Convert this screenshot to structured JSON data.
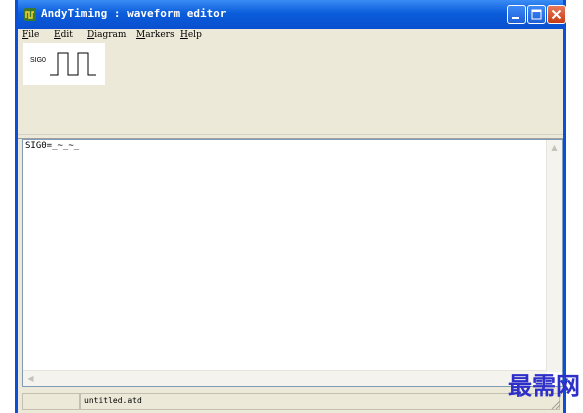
{
  "window": {
    "title": "AndyTiming : waveform editor",
    "buttons": {
      "minimize": "minimize",
      "maximize": "maximize",
      "close": "close"
    }
  },
  "menu": {
    "items": [
      {
        "label": "File",
        "accel": "F"
      },
      {
        "label": "Edit",
        "accel": "E"
      },
      {
        "label": "Diagram",
        "accel": "D"
      },
      {
        "label": "Markers",
        "accel": "M"
      },
      {
        "label": "Help",
        "accel": "H"
      }
    ]
  },
  "waveform": {
    "signal_label": "SIG0",
    "pattern": [
      0,
      1,
      0,
      1,
      0
    ]
  },
  "editor": {
    "text": "SIG0=_~_~_"
  },
  "status": {
    "filename": "untitled.atd"
  },
  "watermark": {
    "text": "最需网"
  },
  "colors": {
    "titlebar": "#0b5ddb",
    "chrome": "#ece9d8",
    "watermark": "#2d2fc8"
  },
  "icons": {
    "app": "andytiming-app-icon",
    "minimize": "minimize-icon",
    "maximize": "maximize-icon",
    "close": "close-icon",
    "scroll_up": "scroll-up-arrow-icon",
    "scroll_down": "scroll-down-arrow-icon",
    "scroll_left": "scroll-left-arrow-icon",
    "resize": "resize-grip-icon"
  }
}
